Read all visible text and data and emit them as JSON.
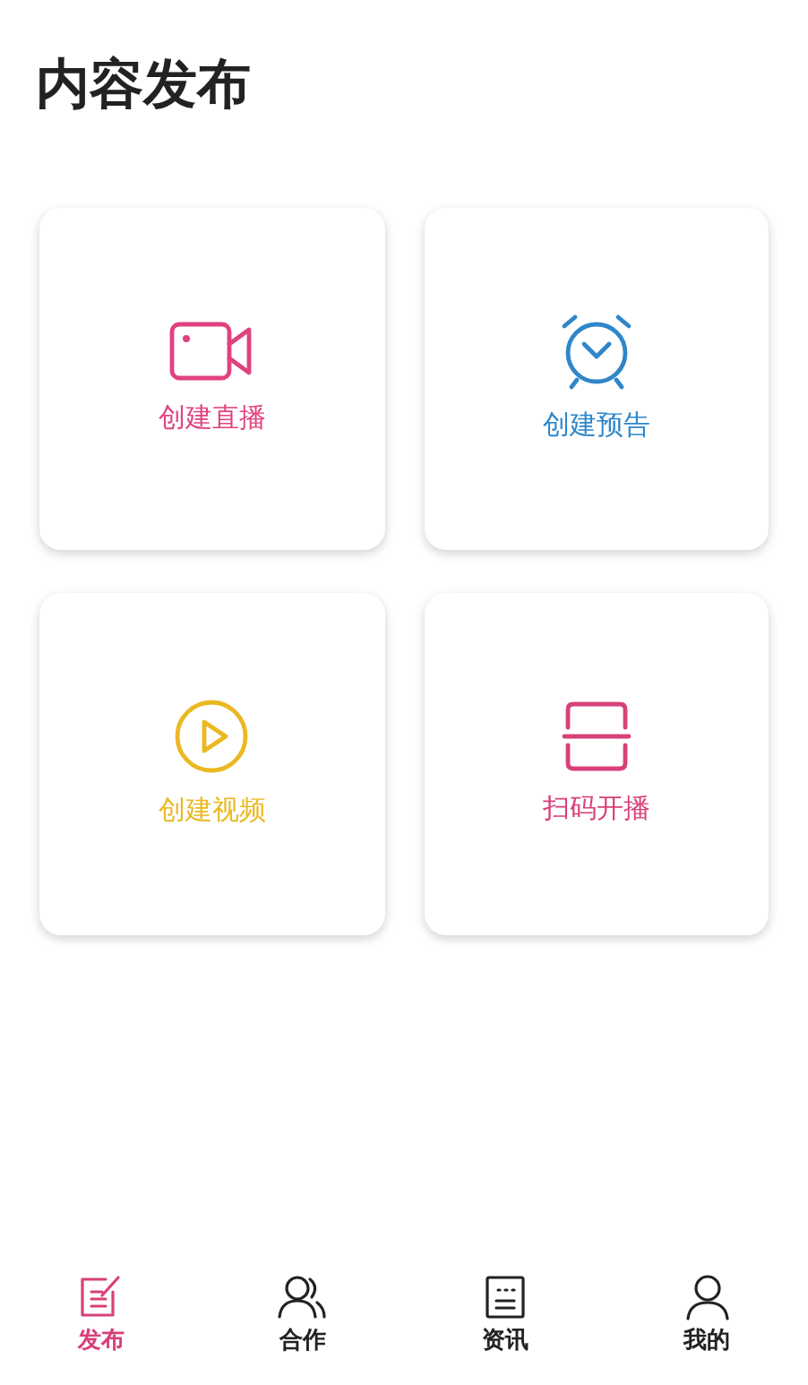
{
  "title": "内容发布",
  "actions": [
    {
      "kind": "camera",
      "label": "创建直播",
      "color": "#e0427f"
    },
    {
      "kind": "alarm",
      "label": "创建预告",
      "color": "#2f86c9"
    },
    {
      "kind": "play",
      "label": "创建视频",
      "color": "#eab820"
    },
    {
      "kind": "scan",
      "label": "扫码开播",
      "color": "#d8407a"
    }
  ],
  "tabs": [
    {
      "kind": "compose",
      "label": "发布",
      "selected": true
    },
    {
      "kind": "people",
      "label": "合作",
      "selected": false
    },
    {
      "kind": "news",
      "label": "资讯",
      "selected": false
    },
    {
      "kind": "person",
      "label": "我的",
      "selected": false
    }
  ]
}
